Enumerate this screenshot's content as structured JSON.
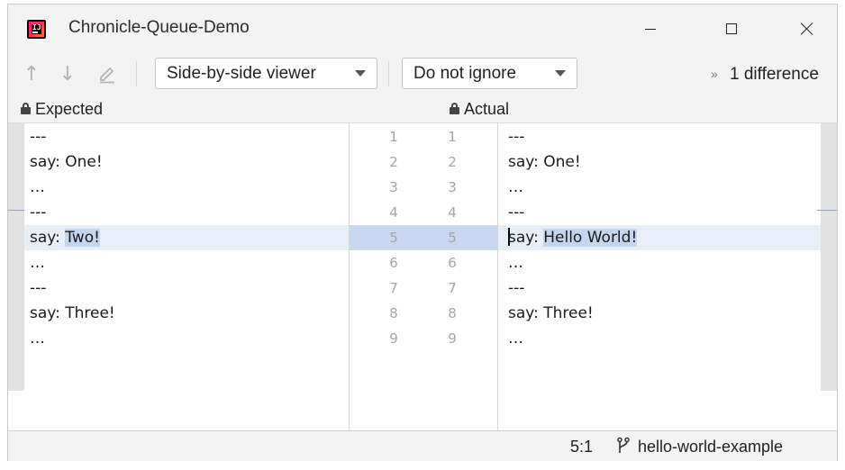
{
  "window": {
    "title": "Chronicle-Queue-Demo",
    "minimize_icon": "minimize-icon",
    "maximize_icon": "maximize-icon",
    "close_icon": "close-icon"
  },
  "toolbar": {
    "prev_diff_icon": "arrow-up-icon",
    "next_diff_icon": "arrow-down-icon",
    "edit_icon": "pencil-icon",
    "viewer_mode": "Side-by-side viewer",
    "ignore_mode": "Do not ignore",
    "more_icon": "chevron-double-right-icon",
    "difference_count": "1 difference"
  },
  "panes": {
    "left_title": "Expected",
    "right_title": "Actual",
    "lock_icon": "lock-icon"
  },
  "left_lines": [
    {
      "num": "1",
      "text": "---"
    },
    {
      "num": "2",
      "text": "say: One!"
    },
    {
      "num": "3",
      "text": "…"
    },
    {
      "num": "4",
      "text": "---"
    },
    {
      "num": "5",
      "prefix": "say: ",
      "changed": "Two!"
    },
    {
      "num": "6",
      "text": "…"
    },
    {
      "num": "7",
      "text": "---"
    },
    {
      "num": "8",
      "text": "say: Three!"
    },
    {
      "num": "9",
      "text": "…"
    }
  ],
  "right_lines": [
    {
      "num": "1",
      "text": "---"
    },
    {
      "num": "2",
      "text": "say: One!"
    },
    {
      "num": "3",
      "text": "…"
    },
    {
      "num": "4",
      "text": "---"
    },
    {
      "num": "5",
      "prefix": "say: ",
      "changed": "Hello World!"
    },
    {
      "num": "6",
      "text": "…"
    },
    {
      "num": "7",
      "text": "---"
    },
    {
      "num": "8",
      "text": "say: Three!"
    },
    {
      "num": "9",
      "text": "…"
    }
  ],
  "status": {
    "caret_position": "5:1",
    "branch_icon": "git-branch-icon",
    "branch": "hello-world-example"
  },
  "colors": {
    "changed_line_bg": "#e8eef8",
    "changed_text_bg": "#c4d5ee",
    "gutter_changed_bg": "#c8d8ef"
  }
}
